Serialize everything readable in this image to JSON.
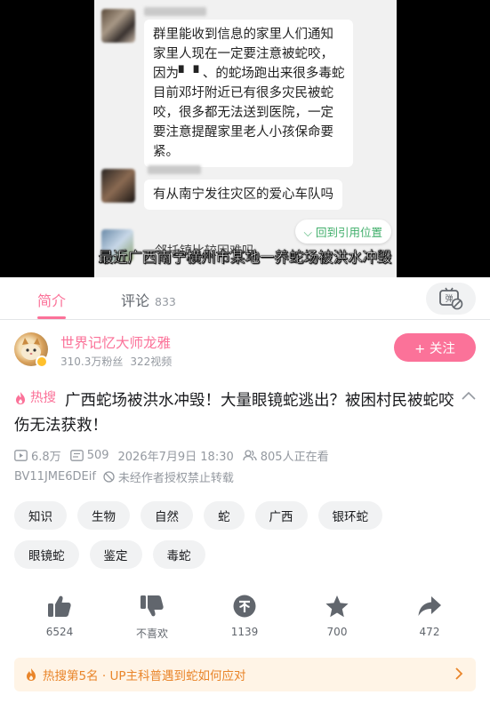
{
  "video": {
    "chat_message_1": "群里能收到信息的家里人们通知\n家里人现在一定要注意被蛇咬，\n因为▘▝ 、的蛇场跑出来很多毒蛇\n目前邓圩附近已有很多灾民被蛇\n咬，很多都无法送到医院，一定\n要注意提醒家里老人小孩保命要\n紧。",
    "chat_message_2": "有从南宁发往灾区的爱心车队吗",
    "jump_button": "回到引用位置",
    "partial_message": "邻托镇比较困难吗",
    "subtitle": "最近广西南宁横州市某地一养蛇场被洪水冲毁"
  },
  "tabs": {
    "intro": "简介",
    "comments": "评论",
    "comment_count": "833"
  },
  "uploader": {
    "name": "世界记忆大师龙雅",
    "fans": "310.3万粉丝",
    "videos": "322视频",
    "follow_label": "+ 关注"
  },
  "video_info": {
    "hot_tag": "热搜",
    "title": "广西蛇场被洪水冲毁！大量眼镜蛇逃出？被困村民被蛇咬伤无法获救！",
    "views": "6.8万",
    "danmaku": "509",
    "date": "2026年7月9日 18:30",
    "watching": "805人正在看",
    "bvid": "BV11JME6DEif",
    "copyright": "未经作者授权禁止转载"
  },
  "tags": [
    "知识",
    "生物",
    "自然",
    "蛇",
    "广西",
    "银环蛇",
    "眼镜蛇",
    "鉴定",
    "毒蛇"
  ],
  "actions": {
    "like": "6524",
    "dislike": "不喜欢",
    "coin": "1139",
    "favorite": "700",
    "share": "472"
  },
  "hot_search": {
    "text": "热搜第5名 · UP主科普遇到蛇如何应对"
  },
  "colors": {
    "accent": "#fb7299",
    "hot_orange": "#e9852a",
    "icon_dark": "#61666d"
  }
}
